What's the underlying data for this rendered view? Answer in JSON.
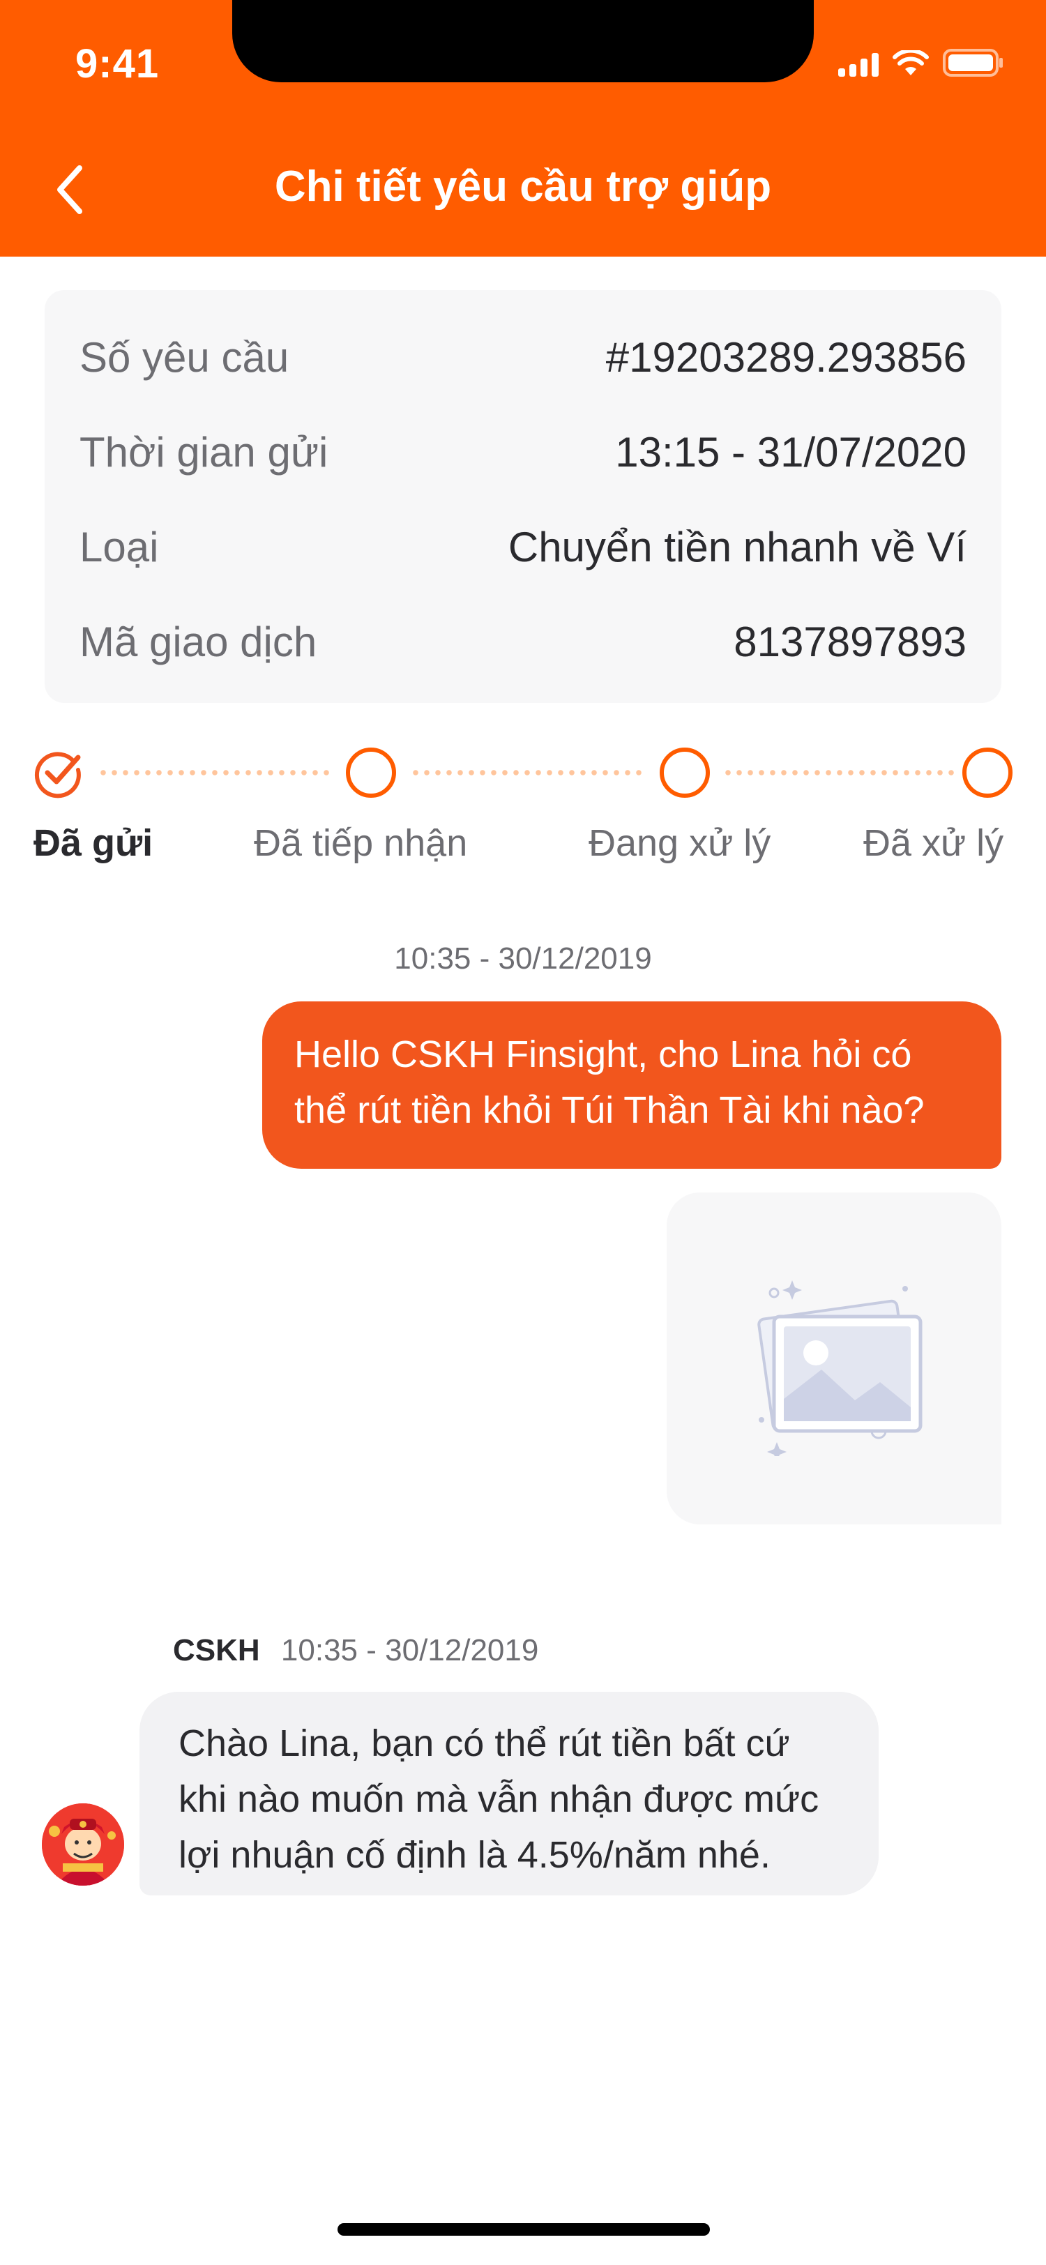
{
  "status_bar": {
    "time": "9:41"
  },
  "header": {
    "title": "Chi tiết yêu cầu trợ giúp"
  },
  "info": {
    "rows": [
      {
        "label": "Số yêu cầu",
        "value": "#19203289.293856"
      },
      {
        "label": "Thời gian gửi",
        "value": "13:15 - 31/07/2020"
      },
      {
        "label": "Loại",
        "value": "Chuyển tiền nhanh về Ví"
      },
      {
        "label": "Mã giao dịch",
        "value": "8137897893"
      }
    ]
  },
  "stepper": {
    "steps": [
      {
        "label": "Đã gửi",
        "done": true
      },
      {
        "label": "Đã tiếp nhận",
        "done": false
      },
      {
        "label": "Đang xử lý",
        "done": false
      },
      {
        "label": "Đã xử lý",
        "done": false
      }
    ]
  },
  "chat": {
    "timestamp": "10:35 - 30/12/2019",
    "outgoing_lines": [
      "Hello CSKH Finsight, cho Lina hỏi có",
      "thể rút tiền khỏi Túi Thần Tài khi nào?"
    ],
    "agent_name": "CSKH",
    "agent_time": "10:35 - 30/12/2019",
    "incoming_lines": [
      "Chào Lina, bạn có thể rút tiền bất cứ",
      "khi nào muốn mà vẫn nhận được mức",
      "lợi nhuận cố định là 4.5%/năm nhé."
    ]
  },
  "colors": {
    "brand": "#ff5c00",
    "bubble_out": "#f2561d",
    "bubble_in": "#f2f2f4"
  }
}
